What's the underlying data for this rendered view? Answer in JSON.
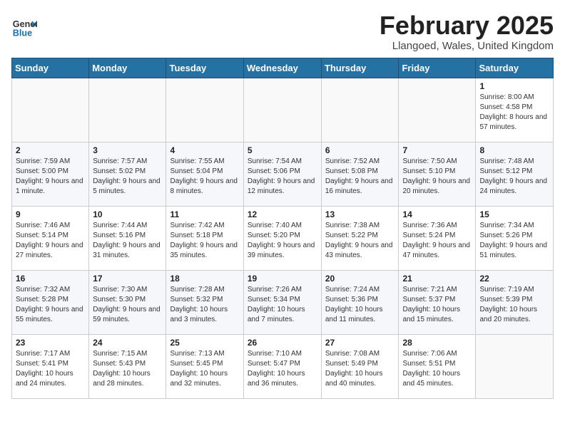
{
  "header": {
    "logo_general": "General",
    "logo_blue": "Blue",
    "month_title": "February 2025",
    "location": "Llangoed, Wales, United Kingdom"
  },
  "weekdays": [
    "Sunday",
    "Monday",
    "Tuesday",
    "Wednesday",
    "Thursday",
    "Friday",
    "Saturday"
  ],
  "weeks": [
    [
      {
        "day": "",
        "detail": ""
      },
      {
        "day": "",
        "detail": ""
      },
      {
        "day": "",
        "detail": ""
      },
      {
        "day": "",
        "detail": ""
      },
      {
        "day": "",
        "detail": ""
      },
      {
        "day": "",
        "detail": ""
      },
      {
        "day": "1",
        "detail": "Sunrise: 8:00 AM\nSunset: 4:58 PM\nDaylight: 8 hours and 57 minutes."
      }
    ],
    [
      {
        "day": "2",
        "detail": "Sunrise: 7:59 AM\nSunset: 5:00 PM\nDaylight: 9 hours and 1 minute."
      },
      {
        "day": "3",
        "detail": "Sunrise: 7:57 AM\nSunset: 5:02 PM\nDaylight: 9 hours and 5 minutes."
      },
      {
        "day": "4",
        "detail": "Sunrise: 7:55 AM\nSunset: 5:04 PM\nDaylight: 9 hours and 8 minutes."
      },
      {
        "day": "5",
        "detail": "Sunrise: 7:54 AM\nSunset: 5:06 PM\nDaylight: 9 hours and 12 minutes."
      },
      {
        "day": "6",
        "detail": "Sunrise: 7:52 AM\nSunset: 5:08 PM\nDaylight: 9 hours and 16 minutes."
      },
      {
        "day": "7",
        "detail": "Sunrise: 7:50 AM\nSunset: 5:10 PM\nDaylight: 9 hours and 20 minutes."
      },
      {
        "day": "8",
        "detail": "Sunrise: 7:48 AM\nSunset: 5:12 PM\nDaylight: 9 hours and 24 minutes."
      }
    ],
    [
      {
        "day": "9",
        "detail": "Sunrise: 7:46 AM\nSunset: 5:14 PM\nDaylight: 9 hours and 27 minutes."
      },
      {
        "day": "10",
        "detail": "Sunrise: 7:44 AM\nSunset: 5:16 PM\nDaylight: 9 hours and 31 minutes."
      },
      {
        "day": "11",
        "detail": "Sunrise: 7:42 AM\nSunset: 5:18 PM\nDaylight: 9 hours and 35 minutes."
      },
      {
        "day": "12",
        "detail": "Sunrise: 7:40 AM\nSunset: 5:20 PM\nDaylight: 9 hours and 39 minutes."
      },
      {
        "day": "13",
        "detail": "Sunrise: 7:38 AM\nSunset: 5:22 PM\nDaylight: 9 hours and 43 minutes."
      },
      {
        "day": "14",
        "detail": "Sunrise: 7:36 AM\nSunset: 5:24 PM\nDaylight: 9 hours and 47 minutes."
      },
      {
        "day": "15",
        "detail": "Sunrise: 7:34 AM\nSunset: 5:26 PM\nDaylight: 9 hours and 51 minutes."
      }
    ],
    [
      {
        "day": "16",
        "detail": "Sunrise: 7:32 AM\nSunset: 5:28 PM\nDaylight: 9 hours and 55 minutes."
      },
      {
        "day": "17",
        "detail": "Sunrise: 7:30 AM\nSunset: 5:30 PM\nDaylight: 9 hours and 59 minutes."
      },
      {
        "day": "18",
        "detail": "Sunrise: 7:28 AM\nSunset: 5:32 PM\nDaylight: 10 hours and 3 minutes."
      },
      {
        "day": "19",
        "detail": "Sunrise: 7:26 AM\nSunset: 5:34 PM\nDaylight: 10 hours and 7 minutes."
      },
      {
        "day": "20",
        "detail": "Sunrise: 7:24 AM\nSunset: 5:36 PM\nDaylight: 10 hours and 11 minutes."
      },
      {
        "day": "21",
        "detail": "Sunrise: 7:21 AM\nSunset: 5:37 PM\nDaylight: 10 hours and 15 minutes."
      },
      {
        "day": "22",
        "detail": "Sunrise: 7:19 AM\nSunset: 5:39 PM\nDaylight: 10 hours and 20 minutes."
      }
    ],
    [
      {
        "day": "23",
        "detail": "Sunrise: 7:17 AM\nSunset: 5:41 PM\nDaylight: 10 hours and 24 minutes."
      },
      {
        "day": "24",
        "detail": "Sunrise: 7:15 AM\nSunset: 5:43 PM\nDaylight: 10 hours and 28 minutes."
      },
      {
        "day": "25",
        "detail": "Sunrise: 7:13 AM\nSunset: 5:45 PM\nDaylight: 10 hours and 32 minutes."
      },
      {
        "day": "26",
        "detail": "Sunrise: 7:10 AM\nSunset: 5:47 PM\nDaylight: 10 hours and 36 minutes."
      },
      {
        "day": "27",
        "detail": "Sunrise: 7:08 AM\nSunset: 5:49 PM\nDaylight: 10 hours and 40 minutes."
      },
      {
        "day": "28",
        "detail": "Sunrise: 7:06 AM\nSunset: 5:51 PM\nDaylight: 10 hours and 45 minutes."
      },
      {
        "day": "",
        "detail": ""
      }
    ]
  ]
}
